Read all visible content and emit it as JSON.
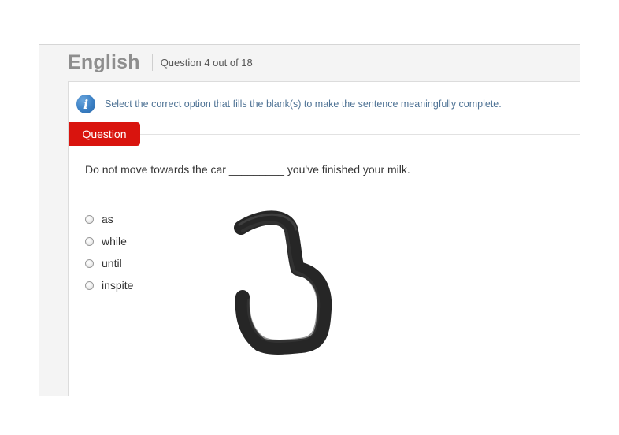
{
  "header": {
    "subject": "English",
    "question_counter": "Question 4 out of 18"
  },
  "instruction": {
    "icon": "info-icon",
    "text": "Select the correct option that fills the blank(s) to make the sentence meaningfully complete."
  },
  "question_tab": {
    "label": "Question",
    "color": "#d9140e"
  },
  "question": {
    "text": "Do not move towards the car _________ you've finished your milk."
  },
  "options": [
    {
      "label": "as",
      "selected": false
    },
    {
      "label": "while",
      "selected": false
    },
    {
      "label": "until",
      "selected": false
    },
    {
      "label": "inspite",
      "selected": false
    }
  ],
  "annotation": {
    "description_icon": "handwritten-digit-3",
    "digit": "3"
  }
}
